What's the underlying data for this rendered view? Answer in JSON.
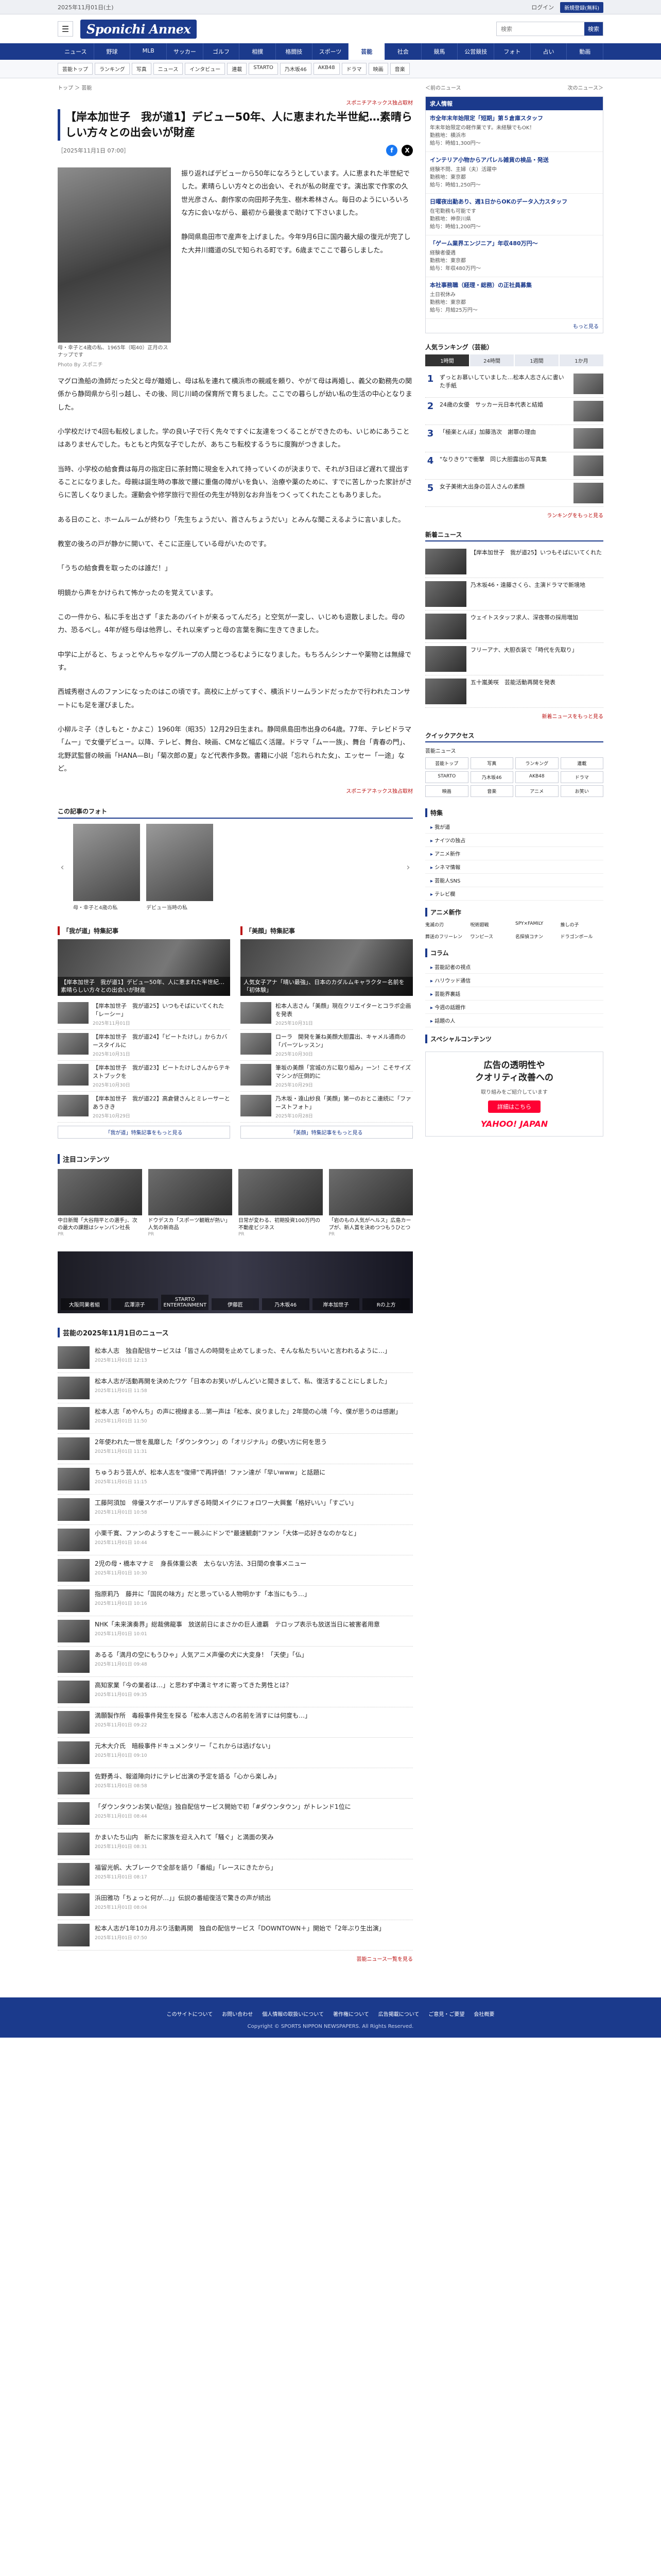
{
  "topbar": {
    "date": "2025年11月01日(土)",
    "login": "ログイン",
    "register": "新規登録(無料)"
  },
  "masthead": {
    "logo": "Sponichi Annex",
    "search_placeholder": "検索",
    "search_button": "検索"
  },
  "nav": [
    "ニュース",
    "野球",
    "MLB",
    "サッカー",
    "ゴルフ",
    "相撲",
    "格闘技",
    "スポーツ",
    "芸能",
    "社会",
    "競馬",
    "公営競技",
    "フォト",
    "占い",
    "動画"
  ],
  "nav_active": "芸能",
  "subnav": [
    "芸能トップ",
    "ランキング",
    "写真",
    "ニュース",
    "インタビュー",
    "連載",
    "STARTO",
    "乃木坂46",
    "AKB48",
    "ドラマ",
    "映画",
    "音楽"
  ],
  "breadcrumb": "トップ ＞ 芸能",
  "article": {
    "label": "スポニチアネックス独占取材",
    "title": "【岸本加世子　我が道1】デビュー50年、人に恵まれた半世紀…素晴らしい方々との出会いが財産",
    "date": "［2025年11月1日 07:00］",
    "photo_caption": "母・幸子と4歳の私、1965年（昭40）正月のスナップです",
    "photo_credit": "Photo By スポニチ",
    "lead_paragraphs": [
      "振り返ればデビューから50年になろうとしています。人に恵まれた半世紀でした。素晴らしい方々との出会い、それが私の財産です。演出家で作家の久世光彦さん、劇作家の向田邦子先生、樹木希林さん。毎日のようにいろいろな方に会いながら、最初から最後まで助けて下さいました。",
      "静岡県島田市で産声を上げました。今年9月6日に国内最大級の復元が完了した大井川鐵道のSLで知られる町です。6歳までここで暮らしました。"
    ],
    "paragraphs": [
      "マグロ漁船の漁師だった父と母が離婚し、母は私を連れて横浜市の親戚を頼り、やがて母は再婚し、義父の勤務先の関係から静岡県から引っ越し、その後、同じ川崎の保育所で育ちました。ここでの暮らしが幼い私の生活の中心となりました。",
      "小学校だけで4回も転校しました。学の良い子で行く先々ですぐに友達をつくることができたのも、いじめにあうことはありませんでした。もともと内気な子でしたが、あちこち転校するうちに度胸がつきました。",
      "当時、小学校の給食費は毎月の指定日に茶封筒に現金を入れて持っていくのが決まりで、それが3日ほど遅れて提出することになりました。母親は誕生時の事故で腰に重傷の障がいを負い、治療や薬のために、すでに苦しかった家計がさらに苦しくなりました。運動会や修学旅行で担任の先生が特別なお弁当をつくってくれたこともありました。",
      "ある日のこと、ホームルームが終わり「先生ちょうだい、首さんちょうだい」とみんな聞こえるように言いました。",
      "教室の後ろの戸が静かに開いて、そこに正座している母がいたのです。",
      "「うちの給食費を取ったのは誰だ！」",
      "明鏡から声をかけられて怖かったのを覚えています。",
      "この一件から、私に手を出さず「またあのバイトが来るってんだろ」と空気が一変し、いじめも退散しました。母の力、恐るべし。4年が経ち母は他界し、それ以来ずっと母の言葉を胸に生きてきました。",
      "中学に上がると、ちょっとやんちゃなグループの人間とつるむようになりました。もちろんシンナーや薬物とは無縁です。",
      "西城秀樹さんのファンになったのはこの頃です。高校に上がってすぐ、横浜ドリームランドだったかで行われたコンサートにも足を運びました。",
      "小柳ルミ子（きしもと・かよこ）1960年（昭35）12月29日生まれ。静岡県島田市出身の64歳。77年、テレビドラマ「ムー」で女優デビュー。以降、テレビ、舞台、映画、CMなど幅広く活躍。ドラマ「ムー一族」、舞台「青春の門」、北野武監督の映画「HANA—BI」「菊次郎の夏」など代表作多数。書籍に小説「忘れられた女」、エッセー「一途」など。"
    ],
    "more_label": "スポニチアネックス独占取材"
  },
  "gallery": {
    "title": "この記事のフォト",
    "items": [
      "母・幸子と4歳の私",
      "デビュー当時の私"
    ]
  },
  "col_left": {
    "title": "「我が道」特集記事",
    "feature": "【岸本加世子　我が道1】デビュー50年、人に恵まれた半世紀…素晴らしい方々との出会いが財産",
    "items": [
      {
        "t": "【岸本加世子　我が道25】いつもそばにいてくれた「レーシー」",
        "d": "2025年11月01日"
      },
      {
        "t": "【岸本加世子　我が道24】「ビートたけし」からカバースタイルに",
        "d": "2025年10月31日"
      },
      {
        "t": "【岸本加世子　我が道23】ビートたけしさんからテキストブックを",
        "d": "2025年10月30日"
      },
      {
        "t": "【岸本加世子　我が道22】高倉健さんとミレーサーとあうきき",
        "d": "2025年10月29日"
      }
    ],
    "more": "「我が道」特集記事をもっと見る"
  },
  "col_right": {
    "title": "「美顔」特集記事",
    "feature": "人気女子アナ「晴い最強」、日本のカダルムキャラクター名前を「初体験」",
    "items": [
      {
        "t": "松本人志さん「美顔」現在クリエイターとコラボ企画を発表",
        "d": "2025年10月31日"
      },
      {
        "t": "ローラ　開発を兼ね美顔大胆露出、キャメル通商の「パーツレッスン」",
        "d": "2025年10月30日"
      },
      {
        "t": "筆坂の美顔「宮城の方に取り組み」ーン！こそサイズマシンが圧倒的に",
        "d": "2025年10月29日"
      },
      {
        "t": "乃木坂・遠山紗良「美顔」第一のおとこ連続に「ファーストフォト」",
        "d": "2025年10月28日"
      }
    ],
    "more": "「美顔」特集記事をもっと見る"
  },
  "attention": {
    "title": "注目コンテンツ",
    "cards": [
      {
        "t": "中日新聞「大谷翔平との選手」、次の最大の課題はシャンパン社長",
        "src": "PR"
      },
      {
        "t": "ドウデスカ「スポーツ観戦が熱い」 人気の新商品",
        "src": "PR"
      },
      {
        "t": "日常が変わる、初期投資100万円の不動産ビジネス",
        "src": "PR"
      },
      {
        "t": "「岩のもの人気がヘルス」広島カープが、新人賞を決めつつもうひとつ",
        "src": "PR"
      }
    ]
  },
  "band": [
    "大阪同業者組",
    "広澤涼子",
    "STARTO ENTERTAINMENT",
    "伊藤匠",
    "乃木坂46",
    "岸本加世子",
    "Rの上方"
  ],
  "latest": {
    "title": "芸能の2025年11月1日のニュース",
    "items": [
      {
        "t": "松本人志　独自配信サービスは「皆さんの時間を止めてしまった、そんな私たちいいと言われるように…」",
        "d": "2025年11月01日 12:13"
      },
      {
        "t": "松本人志が活動再開を決めたワケ「日本のお笑いがしんどいと聞きまして、私、復活することにしました」",
        "d": "2025年11月01日 11:58"
      },
      {
        "t": "松本人志「めやんち」の声に視線まる…第一声は「松本、戻りました」2年間の心境「今、僕が思うのは感謝」",
        "d": "2025年11月01日 11:50"
      },
      {
        "t": "2年使われた一世を風靡した「ダウンタウン」の「オリジナル」の使い方に何を思う",
        "d": "2025年11月01日 11:31"
      },
      {
        "t": "ちゅうおう芸人が、松本人志を\"復帰\"で再評価！ファン達が「早いwww」と話題に",
        "d": "2025年11月01日 11:15"
      },
      {
        "t": "工藤阿須加　俳優スケボーリアルすぎる時間メイクにフォロワー大興奮「格好いい」「すごい」",
        "d": "2025年11月01日 10:58"
      },
      {
        "t": "小栗千寛、ファンのようすをこーー親ふにドンで\"最速観劇\"ファン「大体一応好きなのかなと」",
        "d": "2025年11月01日 10:44"
      },
      {
        "t": "2児の母・橋本マナミ　身長体重公表　太らない方法、3日間の食事メニュー",
        "d": "2025年11月01日 10:30"
      },
      {
        "t": "指原莉乃　藤井に「国民の味方」だと思っている人物明かす「本当にもう…」",
        "d": "2025年11月01日 10:16"
      },
      {
        "t": "NHK「未来演奏界」総裁佛龍事　放送前日にまさかの巨人連覇　テロップ表示も放送当日に被害者用意",
        "d": "2025年11月01日 10:01"
      },
      {
        "t": "あるる「満月の空にもうひゃ」人気アニメ声優の犬に大変身！「天使」「仏」",
        "d": "2025年11月01日 09:48"
      },
      {
        "t": "高知家業「今の業者は…」と思わず中溝ミヤオに寄ってきた男性とは？",
        "d": "2025年11月01日 09:35"
      },
      {
        "t": "満願製作所　毒殺事件発生を探る「松本人志さんの名前を消すには何度も…」",
        "d": "2025年11月01日 09:22"
      },
      {
        "t": "元木大介氏　暗殺事件ドキュメンタリー「これからは逃げない」",
        "d": "2025年11月01日 09:10"
      },
      {
        "t": "佐野勇斗、報道陣向けにテレビ出演の予定を語る「心から楽しみ」",
        "d": "2025年11月01日 08:58"
      },
      {
        "t": "「ダウンタウンお笑い配信」独自配信サービス開始で初「#ダウンタウン」がトレンド1位に",
        "d": "2025年11月01日 08:44"
      },
      {
        "t": "かまいたち山内　新たに家族を迎え入れて「騒ぐ」と満面の笑み",
        "d": "2025年11月01日 08:31"
      },
      {
        "t": "福留光帆、大ブレークで全部を語り「番組」「レースにきたから」",
        "d": "2025年11月01日 08:17"
      },
      {
        "t": "浜田雅功「ちょっと何が…」」伝説の番組復活で驚きの声が続出",
        "d": "2025年11月01日 08:04"
      },
      {
        "t": "松本人志が1年10カ月ぶり活動再開　独自の配信サービス「DOWNTOWN＋」開始で「2年ぶり生出演」",
        "d": "2025年11月01日 07:50"
      }
    ],
    "more": "芸能ニュース一覧を見る"
  },
  "side": {
    "links": [
      "＜前のニュース",
      "次のニュース＞"
    ],
    "jobs_title": "求人情報",
    "jobs": [
      {
        "t": "市全年末年始限定「短期」第５倉庫スタッフ",
        "m": "年末年始限定の軽作業です。未経験でもOK！\n勤務地：横浜市\n給与：時給1,300円〜"
      },
      {
        "t": "インテリア小物からアパレル雑貨の検品・発送",
        "m": "経験不問、主婦（夫）活躍中\n勤務地：東京都\n給与：時給1,250円〜"
      },
      {
        "t": "日曜夜出勤あり、週1日からOKのデータ入力スタッフ",
        "m": "在宅勤務も可能です\n勤務地：神奈川県\n給与：時給1,200円〜"
      },
      {
        "t": "「ゲーム業界エンジニア」年収480万円〜",
        "m": "経験者優遇\n勤務地：東京都\n給与：年収480万円〜"
      },
      {
        "t": "本社事務職（経理・総務）の正社員募集",
        "m": "土日祝休み\n勤務地：東京都\n給与：月給25万円〜"
      }
    ],
    "jobs_more": "もっと見る",
    "ranking_title": "人気ランキング（芸能）",
    "ranking_tabs": [
      "1時間",
      "24時間",
      "1週間",
      "1か月"
    ],
    "ranking": [
      "ずっとお慕いしていました…松本人志さんに書いた手紙",
      "24歳の女優　サッカー元日本代表と結婚",
      "「極楽とんぼ」加藤浩次　謝罪の理由",
      "\"なりきり\"で衝撃　同じ大胆露出の写真集",
      "女子美術大出身の芸人さんの素顔"
    ],
    "ranking_more": "ランキングをもっと見る",
    "news_title": "新着ニュース",
    "news": [
      "【岸本加世子　我が道25】いつもそばにいてくれた",
      "乃木坂46・遠藤さくら、主演ドラマで新境地",
      "ウェイトスタッフ求人、深夜帯の採用増加",
      "フリーアナ、大胆衣装で「時代を先取り」",
      "五十嵐美咲　芸能活動再開を発表"
    ],
    "news_more": "新着ニュースをもっと見る",
    "quick_title": "クイックアクセス",
    "quick_first": "芸能ニュース",
    "quick": [
      "芸能トップ",
      "写真",
      "ランキング",
      "連載",
      "STARTO",
      "乃木坂46",
      "AKB48",
      "ドラマ",
      "映画",
      "音楽",
      "アニメ",
      "お笑い"
    ],
    "special_title": "特集",
    "special": [
      "我が道",
      "ナイツの独占",
      "アニメ新作",
      "シネマ情報",
      "芸能人SNS",
      "テレビ欄"
    ],
    "anime_title": "アニメ新作",
    "anime": [
      "鬼滅の刃",
      "呪術廻戦",
      "SPY×FAMILY",
      "推しの子",
      "葬送のフリーレン",
      "ワンピース",
      "名探偵コナン",
      "ドラゴンボール"
    ],
    "column_title": "コラム",
    "columns": [
      "芸能記者の視点",
      "ハリウッド通信",
      "芸能界裏話",
      "今週の話題作",
      "話題の人"
    ],
    "ad_title": "スペシャルコンテンツ",
    "ad_line1": "広告の透明性や\nクオリティ改善への",
    "ad_line2": "取り組みをご紹介しています",
    "ad_button": "詳細はこちら",
    "ad_brand": "YAHOO! JAPAN"
  },
  "footer": {
    "links": [
      "このサイトについて",
      "お問い合わせ",
      "個人情報の取扱いについて",
      "著作権について",
      "広告掲載について",
      "ご意見・ご要望",
      "会社概要"
    ],
    "copy": "Copyright © SPORTS NIPPON NEWSPAPERS. All Rights Reserved."
  }
}
